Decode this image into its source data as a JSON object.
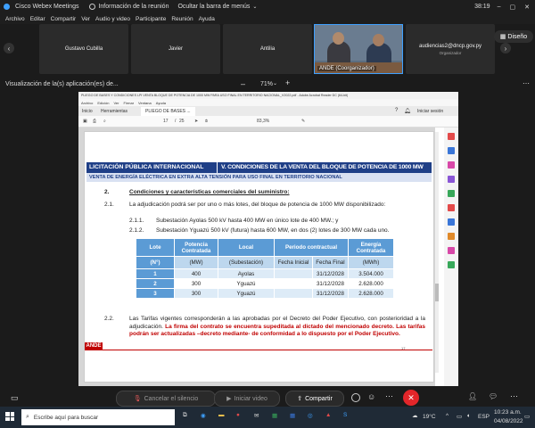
{
  "titlebar": {
    "app": "Cisco Webex Meetings",
    "info": "Información de la reunión",
    "hide": "Ocultar la barra de menús",
    "time": "38:19"
  },
  "menu": [
    "Archivo",
    "Editar",
    "Compartir",
    "Ver",
    "Audio y video",
    "Participante",
    "Reunión",
    "Ayuda"
  ],
  "participants": [
    {
      "name": "Gustavo Cubilla"
    },
    {
      "name": "Javier"
    },
    {
      "name": "Antilia"
    }
  ],
  "video": {
    "name": "ANDE (Coorganizador)"
  },
  "organizer": {
    "email": "audiencias2@dncp.gov.py",
    "role": "Organizador"
  },
  "layout_label": "Diseño",
  "share": {
    "label": "Visualización de la(s) aplicación(es) de...",
    "zoom": "71%"
  },
  "pdf": {
    "title": "PLIEGO DE BASES Y CONDICIONES LPI VENTA BLOQUE DE POTENCIA DE 1000 MW PARA USO FINAL EN TERRITORIO NACIONAL_V2022.pdf - Adobe Acrobat Reader DC (64-bit)",
    "menu": [
      "Archivo",
      "Edición",
      "Ver",
      "Firmar",
      "Ventana",
      "Ayuda"
    ],
    "tabs": [
      "Inicio",
      "Herramientas",
      "PLIEGO DE BASES ..."
    ],
    "signin": "Iniciar sesión",
    "page_current": "17",
    "page_total": "25",
    "zoom": "83,3%",
    "heading_left": "LICITACIÓN PÚBLICA INTERNACIONAL",
    "heading_right": "V. CONDICIONES DE LA VENTA DEL BLOQUE DE POTENCIA DE 1000 MW",
    "subheading": "VENTA DE ENERGÍA ELÉCTRICA EN EXTRA ALTA TENSIÓN PARA USO FINAL EN TERRITORIO NACIONAL",
    "section_num": "2.",
    "section_title": "Condiciones y características comerciales del suministro:",
    "p21_num": "2.1.",
    "p21_text": "La adjudicación podrá ser por uno o más lotes, del bloque de potencia de 1000 MW disponibilizado:",
    "p211_num": "2.1.1.",
    "p211_text": "Subestación Ayolas 500 kV hasta 400 MW en único lote de 400 MW.; y",
    "p212_num": "2.1.2.",
    "p212_text": "Subestación Yguazú 500 kV (futura) hasta 600 MW, en dos (2) lotes de 300 MW cada uno.",
    "table": {
      "headers": [
        "Lote",
        "Potencia Contratada",
        "Local",
        "Periodo contractual",
        "Energía Contratada"
      ],
      "units": [
        "(N°)",
        "(MW)",
        "(Subestación)",
        "Fecha Inicial",
        "Fecha Final",
        "(MWh)"
      ],
      "rows": [
        [
          "1",
          "400",
          "Ayolas",
          "",
          "31/12/2028",
          "3.504.000"
        ],
        [
          "2",
          "300",
          "Yguazú",
          "",
          "31/12/2028",
          "2.628.000"
        ],
        [
          "3",
          "300",
          "Yguazú",
          "",
          "31/12/2028",
          "2.628.000"
        ]
      ]
    },
    "p22_num": "2.2.",
    "p22_black": "Las Tarifas vigentes corresponderán a las aprobadas por el Decreto del Poder Ejecutivo, con posterioridad a la adjudicación.",
    "p22_red": "La firma del contrato se encuentra supeditada al dictado del mencionado decreto. Las tarifas podrán ser actualizadas –decreto mediante- de conformidad a lo dispuesto por el Poder Ejecutivo.",
    "logo": "ANDE",
    "page_foot": "17"
  },
  "controls": {
    "mute": "Cancelar el silencio",
    "video": "Iniciar video",
    "share": "Compartir"
  },
  "taskbar": {
    "search": "Escribe aquí para buscar",
    "weather": "19°C",
    "lang": "ESP",
    "time": "10:23 a.m.",
    "date": "04/08/2022"
  },
  "colors": {
    "heading_bg": "#1f3f87",
    "subheading_bg": "#d9e1f2",
    "table_header": "#5b9bd5",
    "table_units": "#bdd7ee",
    "red": "#c00000",
    "end_call": "#e3262a"
  }
}
